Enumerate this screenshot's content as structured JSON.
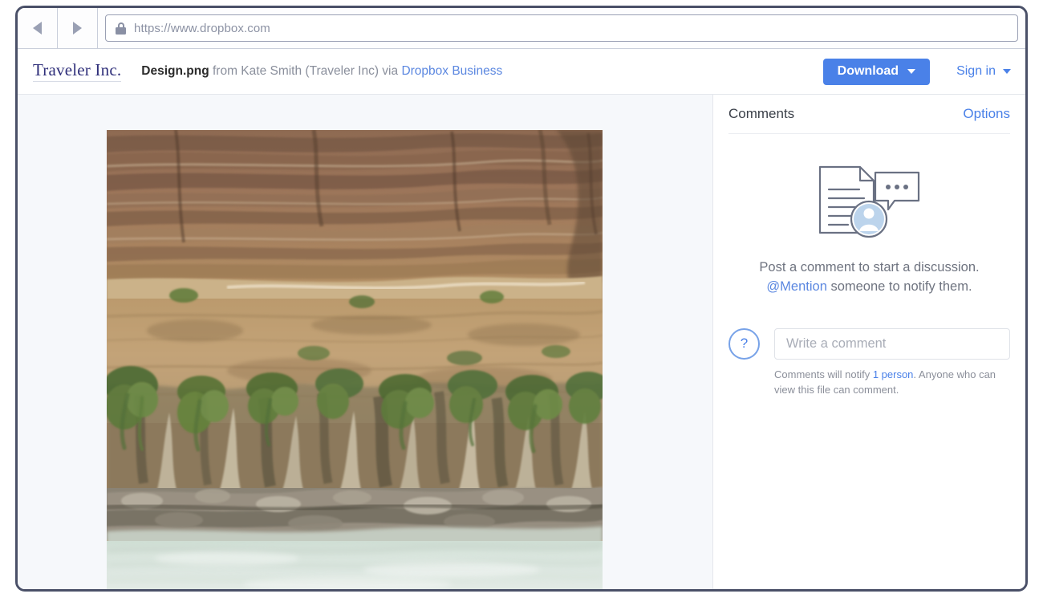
{
  "browser": {
    "back_icon": "triangle-left-icon",
    "forward_icon": "triangle-right-icon",
    "lock_icon": "padlock-icon",
    "url": "https://www.dropbox.com"
  },
  "header": {
    "brand": "Traveler Inc.",
    "file_name": "Design.png",
    "from_text": " from Kate Smith (Traveler Inc) via ",
    "service_link": "Dropbox Business",
    "download_label": "Download",
    "download_caret": "caret-down-icon",
    "signin_label": "Sign in",
    "signin_caret": "caret-down-icon",
    "accent_blue": "#4a81e8",
    "brand_color": "#2f2f7a"
  },
  "preview": {
    "image_alt": "Design.png",
    "image_description": "Layered sandstone canyon wall with hanging green vegetation above pale turquoise river water"
  },
  "comments": {
    "title": "Comments",
    "options_label": "Options",
    "illustration_icon": "document-comment-avatar-illustration",
    "empty_line1": "Post a comment to start a discussion.",
    "empty_mention": "@Mention",
    "empty_line2_rest": " someone to notify them.",
    "avatar_label": "?",
    "avatar_icon": "question-avatar-icon",
    "input_placeholder": "Write a comment",
    "input_value": "",
    "notify_prefix": "Comments will notify ",
    "notify_count": "1 person",
    "notify_suffix": ". Anyone who can view this file can comment."
  }
}
